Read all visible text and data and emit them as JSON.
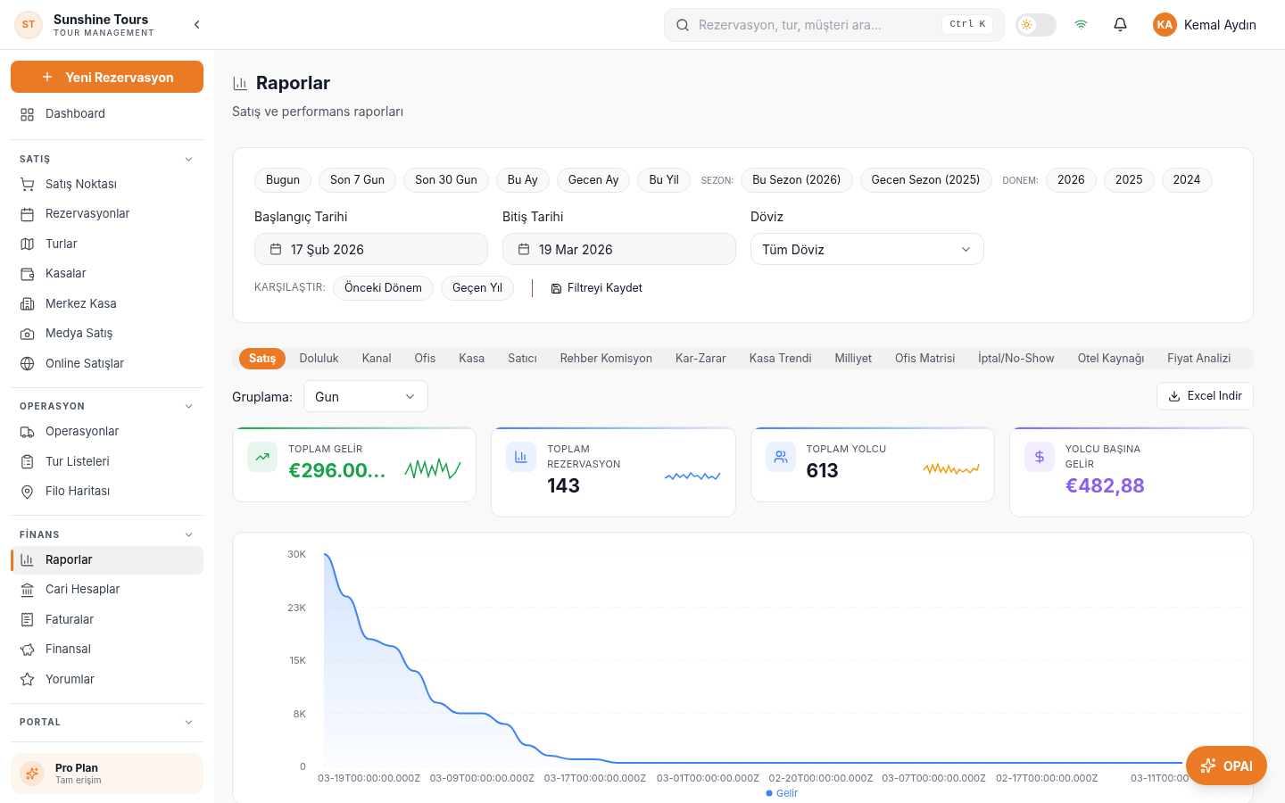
{
  "brand": {
    "initials": "ST",
    "name": "Sunshine Tours",
    "subtitle": "TOUR MANAGEMENT"
  },
  "header": {
    "search_placeholder": "Rezervasyon, tur, müşteri ara...",
    "shortcut": "Ctrl K",
    "theme_dark": false,
    "user": {
      "initials": "KA",
      "name": "Kemal Aydın"
    }
  },
  "sidebar": {
    "new_button": "Yeni Rezervasyon",
    "top_items": [
      {
        "label": "Dashboard",
        "selected": false
      }
    ],
    "sections": [
      {
        "title": "SATIŞ",
        "items": [
          {
            "label": "Satış Noktası",
            "selected": false
          },
          {
            "label": "Rezervasyonlar",
            "selected": false
          },
          {
            "label": "Turlar",
            "selected": false
          },
          {
            "label": "Kasalar",
            "selected": false
          },
          {
            "label": "Merkez Kasa",
            "selected": false
          },
          {
            "label": "Medya Satış",
            "selected": false
          },
          {
            "label": "Online Satışlar",
            "selected": false
          }
        ]
      },
      {
        "title": "OPERASYON",
        "items": [
          {
            "label": "Operasyonlar",
            "selected": false
          },
          {
            "label": "Tur Listeleri",
            "selected": false
          },
          {
            "label": "Filo Haritası",
            "selected": false
          }
        ]
      },
      {
        "title": "FİNANS",
        "items": [
          {
            "label": "Raporlar",
            "selected": true
          },
          {
            "label": "Cari Hesaplar",
            "selected": false
          },
          {
            "label": "Faturalar",
            "selected": false
          },
          {
            "label": "Finansal",
            "selected": false
          },
          {
            "label": "Yorumlar",
            "selected": false
          }
        ]
      },
      {
        "title": "PORTAL"
      }
    ],
    "plan": {
      "title": "Pro Plan",
      "subtitle": "Tam erişim"
    }
  },
  "page": {
    "title": "Raporlar",
    "subtitle": "Satış ve performans raporları"
  },
  "filters": {
    "quick": [
      {
        "kind": "chip",
        "label": "Bugun"
      },
      {
        "kind": "chip",
        "label": "Son 7 Gun"
      },
      {
        "kind": "chip",
        "label": "Son 30 Gun"
      },
      {
        "kind": "chip",
        "label": "Bu Ay"
      },
      {
        "kind": "chip",
        "label": "Gecen Ay"
      },
      {
        "kind": "chip",
        "label": "Bu Yil"
      },
      {
        "kind": "label",
        "label": "SEZON:"
      },
      {
        "kind": "chip",
        "label": "Bu Sezon (2026)"
      },
      {
        "kind": "chip",
        "label": "Gecen Sezon (2025)"
      },
      {
        "kind": "label",
        "label": "DONEM:"
      },
      {
        "kind": "chip",
        "label": "2026"
      },
      {
        "kind": "chip",
        "label": "2025"
      },
      {
        "kind": "chip",
        "label": "2024"
      }
    ],
    "start": {
      "label": "Başlangıç Tarihi",
      "value": "17 Şub 2026"
    },
    "end": {
      "label": "Bitiş Tarihi",
      "value": "19 Mar 2026"
    },
    "currency": {
      "label": "Döviz",
      "value": "Tüm Döviz"
    },
    "compare": {
      "label": "KARŞILAŞTIR:",
      "options": [
        "Önceki Dönem",
        "Geçen Yıl"
      ]
    },
    "save": "Filtreyi Kaydet"
  },
  "tabs": [
    {
      "label": "Satış",
      "selected": true
    },
    {
      "label": "Doluluk",
      "selected": false
    },
    {
      "label": "Kanal",
      "selected": false
    },
    {
      "label": "Ofis",
      "selected": false
    },
    {
      "label": "Kasa",
      "selected": false
    },
    {
      "label": "Satıcı",
      "selected": false
    },
    {
      "label": "Rehber Komisyon",
      "selected": false
    },
    {
      "label": "Kar-Zarar",
      "selected": false
    },
    {
      "label": "Kasa Trendi",
      "selected": false
    },
    {
      "label": "Milliyet",
      "selected": false
    },
    {
      "label": "Ofis Matrisi",
      "selected": false
    },
    {
      "label": "İptal/No-Show",
      "selected": false
    },
    {
      "label": "Otel Kaynağı",
      "selected": false
    },
    {
      "label": "Fiyat Analizi",
      "selected": false
    }
  ],
  "grouping": {
    "label": "Gruplama:",
    "value": "Gun"
  },
  "export": "Excel Indir",
  "stats": [
    {
      "label": "TOPLAM GELİR",
      "value": "€296.00...",
      "kind": "money",
      "color": "#16a34a"
    },
    {
      "label": "TOPLAM REZERVASYON",
      "value": "143",
      "kind": "count",
      "color": "#3b82f6"
    },
    {
      "label": "TOPLAM YOLCU",
      "value": "613",
      "kind": "count",
      "color": "#3b82f6"
    },
    {
      "label": "YOLCU BAŞINA GELİR",
      "value": "€482,88",
      "kind": "money",
      "color": "#8b5cf6"
    }
  ],
  "chart": {
    "chart_data": {
      "type": "area",
      "grid": true,
      "categories": [
        null,
        null,
        "03-19T00:00:00.000Z",
        null,
        null,
        null,
        null,
        "03-09T00:00:00.000Z",
        null,
        null,
        null,
        null,
        "03-17T00:00:00.000Z",
        null,
        null,
        null,
        null,
        "03-01T00:00:00.000Z",
        null,
        null,
        null,
        null,
        "02-20T00:00:00.000Z",
        null,
        null,
        null,
        null,
        "03-07T00:00:00.000Z",
        null,
        null,
        null,
        null,
        "02-17T00:00:00.000Z",
        null,
        null,
        null,
        null,
        "03-11T00:00",
        null
      ],
      "series": [
        {
          "name": "Gelir",
          "color": "#3b82f6",
          "values": [
            30000,
            24000,
            18000,
            17000,
            13500,
            9000,
            7500,
            7500,
            6000,
            3000,
            1500,
            1000,
            1000,
            500,
            500,
            500,
            500,
            500,
            500,
            500,
            500,
            500,
            500,
            500,
            500,
            500,
            500,
            500,
            500,
            500,
            500,
            500,
            500,
            500,
            500,
            500,
            500,
            500,
            500
          ]
        }
      ],
      "ylim": [
        0,
        30000
      ],
      "yticks": [
        0,
        {
          "value": 7500,
          "label": "8K"
        },
        {
          "value": 15000,
          "label": "15K"
        },
        {
          "value": 22500,
          "label": "23K"
        },
        {
          "value": 30000,
          "label": "30K"
        }
      ]
    }
  },
  "assistant_button": "OPAI"
}
